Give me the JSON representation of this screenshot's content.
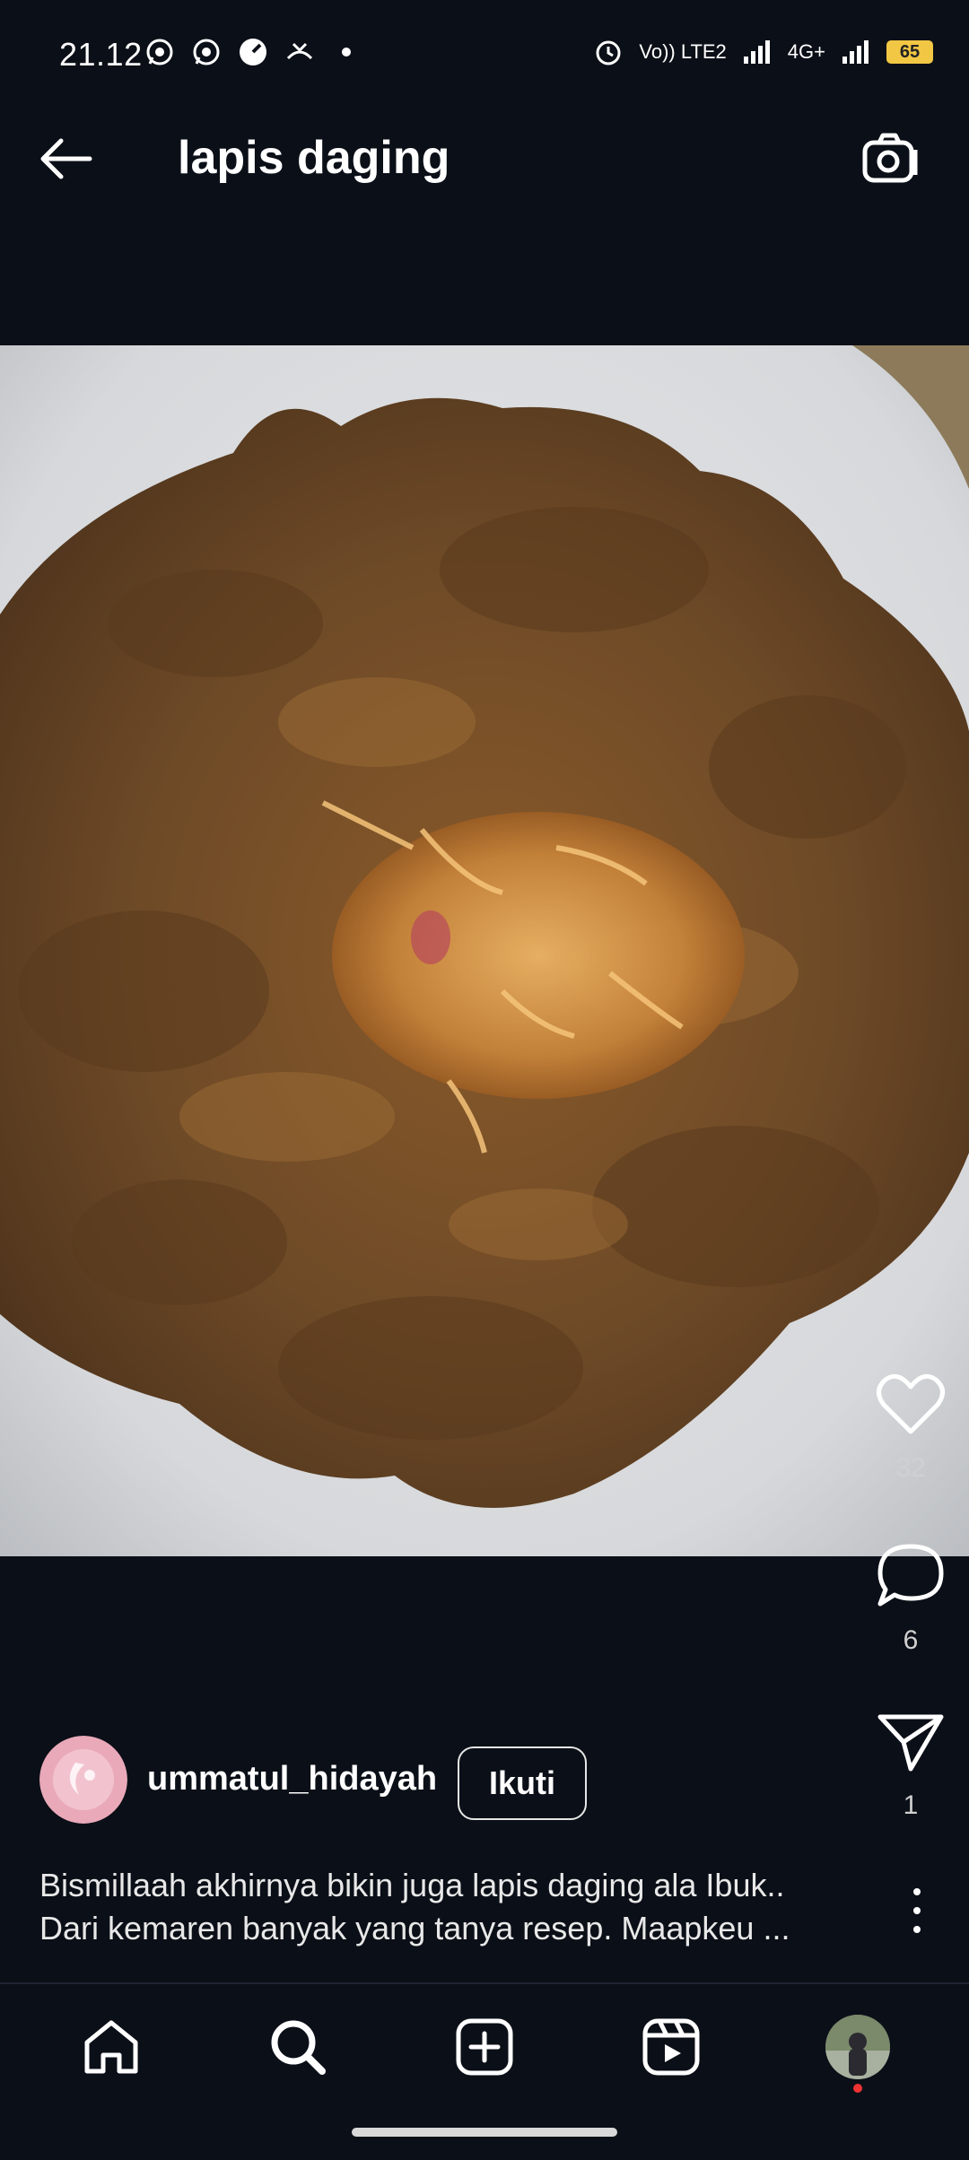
{
  "status_bar": {
    "time": "21.12",
    "icons_left": [
      "whatsapp-icon",
      "whatsapp-icon",
      "speedometer-icon",
      "missed-call-icon",
      "dot"
    ],
    "volte": "Vo)) LTE2",
    "network": "4G+",
    "battery": "65",
    "battery_color": "#f2c744"
  },
  "header": {
    "title": "lapis daging",
    "back_icon": "arrow-left-icon",
    "camera_icon": "camera-icon"
  },
  "post": {
    "likes": "32",
    "comments": "6",
    "shares": "1",
    "author": "ummatul_hidayah",
    "follow_label": "Ikuti",
    "caption_line1": "Bismillaah akhirnya bikin juga lapis daging ala Ibuk..",
    "caption_line2": "Dari kemaren banyak yang tanya resep. Maapkeu ..."
  },
  "nav": {
    "items": [
      "home-icon",
      "search-icon",
      "create-icon",
      "reels-icon",
      "profile-avatar"
    ]
  }
}
